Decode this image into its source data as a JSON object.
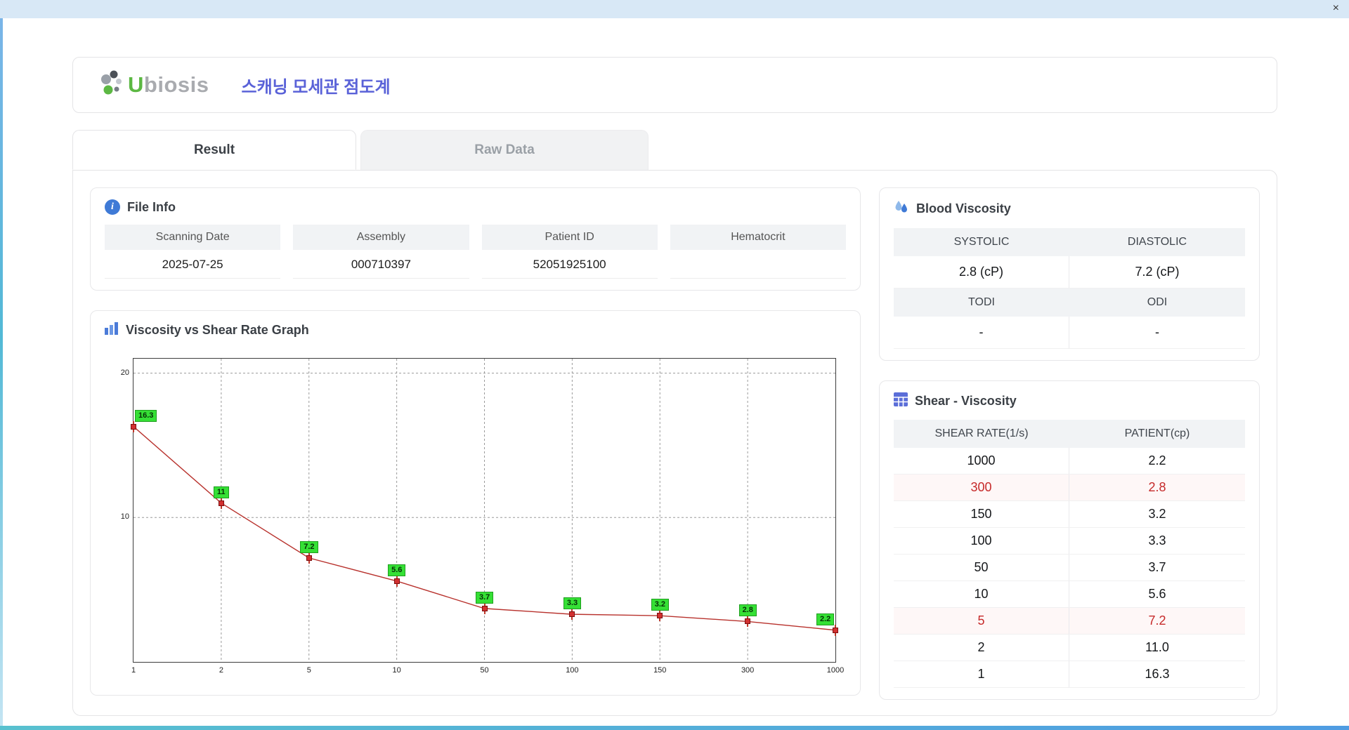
{
  "window": {
    "close_label": "×"
  },
  "header": {
    "logo_u": "U",
    "logo_rest": "biosis",
    "title": "스캐닝 모세관 점도계"
  },
  "tabs": [
    {
      "label": "Result",
      "active": true
    },
    {
      "label": "Raw Data",
      "active": false
    }
  ],
  "file_info": {
    "title": "File Info",
    "fields": [
      {
        "label": "Scanning Date",
        "value": "2025-07-25"
      },
      {
        "label": "Assembly",
        "value": "000710397"
      },
      {
        "label": "Patient ID",
        "value": "52051925100"
      },
      {
        "label": "Hematocrit",
        "value": ""
      }
    ]
  },
  "blood_viscosity": {
    "title": "Blood Viscosity",
    "rows": [
      {
        "headers": [
          "SYSTOLIC",
          "DIASTOLIC"
        ],
        "values": [
          "2.8 (cP)",
          "7.2 (cP)"
        ]
      },
      {
        "headers": [
          "TODI",
          "ODI"
        ],
        "values": [
          "-",
          "-"
        ]
      }
    ]
  },
  "shear_viscosity": {
    "title": "Shear - Viscosity",
    "columns": [
      "SHEAR RATE(1/s)",
      "PATIENT(cp)"
    ],
    "rows": [
      {
        "rate": "1000",
        "value": "2.2",
        "highlight": false
      },
      {
        "rate": "300",
        "value": "2.8",
        "highlight": true
      },
      {
        "rate": "150",
        "value": "3.2",
        "highlight": false
      },
      {
        "rate": "100",
        "value": "3.3",
        "highlight": false
      },
      {
        "rate": "50",
        "value": "3.7",
        "highlight": false
      },
      {
        "rate": "10",
        "value": "5.6",
        "highlight": false
      },
      {
        "rate": "5",
        "value": "7.2",
        "highlight": true
      },
      {
        "rate": "2",
        "value": "11.0",
        "highlight": false
      },
      {
        "rate": "1",
        "value": "16.3",
        "highlight": false
      }
    ]
  },
  "chart_data": {
    "type": "line",
    "title": "Viscosity vs Shear Rate Graph",
    "x": [
      1,
      2,
      5,
      10,
      50,
      100,
      150,
      300,
      1000
    ],
    "x_tick_labels": [
      "1",
      "2",
      "5",
      "10",
      "50",
      "100",
      "150",
      "300",
      "1000"
    ],
    "values": [
      16.3,
      11,
      7.2,
      5.6,
      3.7,
      3.3,
      3.2,
      2.8,
      2.2
    ],
    "point_labels": [
      "16.3",
      "11",
      "7.2",
      "5.6",
      "3.7",
      "3.3",
      "3.2",
      "2.8",
      "2.2"
    ],
    "xlabel": "",
    "ylabel": "",
    "ylim": [
      0,
      21
    ],
    "y_ticks": [
      10,
      20
    ],
    "grid": "dashed",
    "legend": "none",
    "line_color": "#b8322d",
    "point_color": "#d33030",
    "label_bg": "#35e035"
  },
  "colors": {
    "accent_blue": "#3f7ad6",
    "title_blue": "#5a62d8",
    "logo_green": "#5cb843",
    "highlight_red": "#c62a2a",
    "titlebar": "#d8e8f6"
  }
}
